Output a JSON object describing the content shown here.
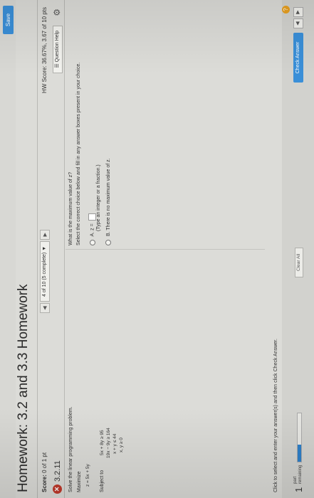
{
  "header": {
    "save_label": "Save",
    "title": "Homework: 3.2 and 3.3 Homework",
    "score_label": "Score:",
    "score_value": "0 of 1 pt",
    "nav_prev": "◀",
    "nav_status": "4 of 10 (5 complete)",
    "nav_dropdown": "▼",
    "nav_next": "▶",
    "hw_score": "HW Score: 36.67%, 3.67 of 10 pts",
    "question_number": "3.2.11",
    "question_help": "Question Help",
    "wrong_icon": "x-circle-icon",
    "gear_icon": "gear-icon",
    "help_icon": "list-icon"
  },
  "problem": {
    "prompt": "Solve the linear programming problem.",
    "maximize_label": "Maximize",
    "objective": "z = 5x + 5y",
    "subject_to_label": "Subject to",
    "constraints": [
      "5x + 8y ≥ 95",
      "19x − 9y ≥ 164",
      "x + y ≤ 44",
      "x, y ≥ 0"
    ]
  },
  "answer": {
    "question": "What is the maximum value of z?",
    "instruction": "Select the correct choice below and fill in any answer boxes present in your choice.",
    "option_a_letter": "A.",
    "option_a_text": "z =",
    "option_a_hint": "(Type an integer or a fraction.)",
    "option_b_letter": "B.",
    "option_b_text": "There is no maximum value of z."
  },
  "footer": {
    "click_instruction": "Click to select and enter your answer(s) and then click Check Answer.",
    "part_number": "1",
    "part_label_1": "part",
    "part_label_2": "remaining",
    "progress_fraction": 0.35,
    "clear_all": "Clear All",
    "check_answer": "Check Answer",
    "prev": "◀",
    "next": "▶",
    "help": "?"
  },
  "colors": {
    "accent": "#3a8fd8",
    "wrong": "#c0392b",
    "help": "#e8a020"
  }
}
